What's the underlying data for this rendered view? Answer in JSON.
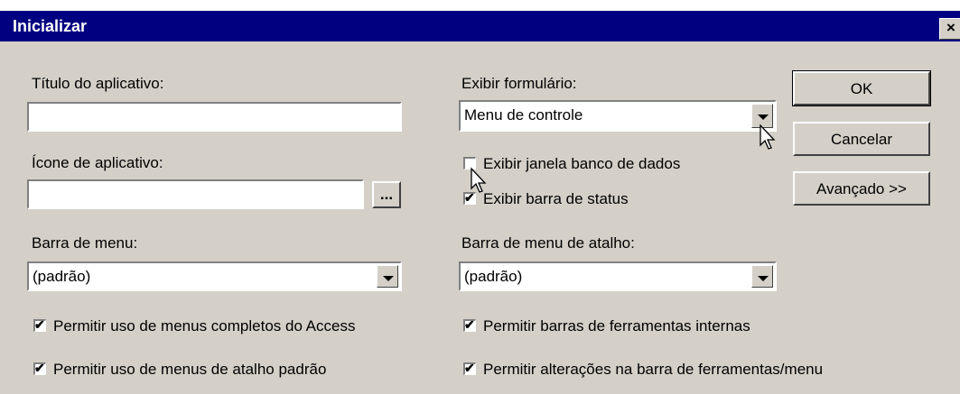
{
  "window": {
    "title": "Inicializar",
    "close_glyph": "×"
  },
  "fields": {
    "titulo_label": "Título do aplicativo:",
    "titulo_value": "",
    "icone_label": "Ícone de aplicativo:",
    "icone_value": "",
    "icone_browse": "...",
    "barra_menu_label": "Barra de menu:",
    "barra_menu_value": "(padrão)",
    "exibir_form_label": "Exibir formulário:",
    "exibir_form_value": "Menu de controle",
    "barra_atalho_label": "Barra de menu de atalho:",
    "barra_atalho_value": "(padrão)"
  },
  "checkboxes": {
    "janela_bd": {
      "label": "Exibir janela banco de dados",
      "checked": false
    },
    "barra_status": {
      "label": "Exibir barra de status",
      "checked": true
    },
    "menus_completos": {
      "label": "Permitir uso de menus completos do Access",
      "checked": true
    },
    "menus_atalho": {
      "label": "Permitir uso de menus de atalho padrão",
      "checked": true
    },
    "barras_internas": {
      "label": "Permitir barras de ferramentas internas",
      "checked": true
    },
    "alteracoes_barras": {
      "label": "Permitir alterações na barra de ferramentas/menu",
      "checked": true
    }
  },
  "buttons": {
    "ok": "OK",
    "cancelar": "Cancelar",
    "avancado": "Avançado >>"
  },
  "check_glyph": "✔",
  "icons": {
    "dropdown": "triangle-down",
    "cursor": "arrow-pointer",
    "close": "close-x"
  },
  "colors": {
    "titlebar": "#000080",
    "face": "#d4d0c8"
  }
}
